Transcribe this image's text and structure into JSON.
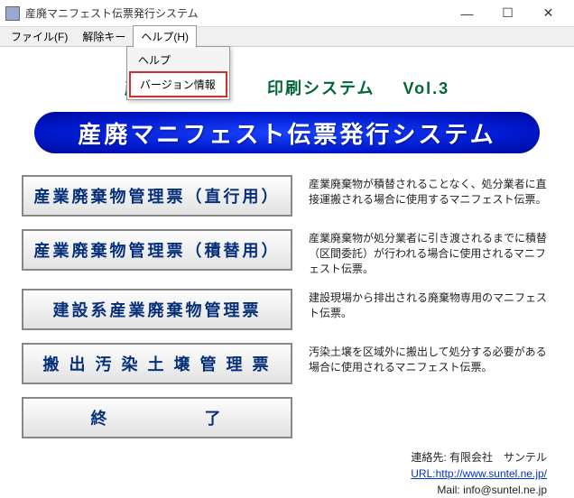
{
  "window": {
    "title": "産廃マニフェスト伝票発行システム",
    "minimize": "—",
    "maximize": "☐",
    "close": "✕"
  },
  "menubar": {
    "file": "ファイル(F)",
    "unlock": "解除キー",
    "help": "ヘルプ(H)"
  },
  "dropdown": {
    "help": "ヘルプ",
    "version": "バージョン情報"
  },
  "heading": {
    "left": "産業廃",
    "right": "印刷システム",
    "vol": "Vol.3"
  },
  "banner": "産廃マニフェスト伝票発行システム",
  "buttons": {
    "b1": "産業廃棄物管理票（直行用）",
    "b2": "産業廃棄物管理票（積替用）",
    "b3": "建設系産業廃棄物管理票",
    "b4": "搬 出 汚 染 土 壌 管 理 票",
    "b5": "終　　　　　了"
  },
  "desc": {
    "d1": "産業廃棄物が積替されることなく、処分業者に直接運搬される場合に使用するマニフェスト伝票。",
    "d2": "産業廃棄物が処分業者に引き渡されるまでに積替（区間委託）が行われる場合に使用されるマニフェスト伝票。",
    "d3": "建設現場から排出される廃棄物専用のマニフェスト伝票。",
    "d4": "汚染土壌を区域外に搬出して処分する必要がある場合に使用されるマニフェスト伝票。"
  },
  "footer": {
    "contact": "連絡先:  有限会社　サンテル",
    "url_label": "URL:",
    "url": "http://www.suntel.ne.jp/",
    "mail": "Mail: info@suntel.ne.jp"
  }
}
